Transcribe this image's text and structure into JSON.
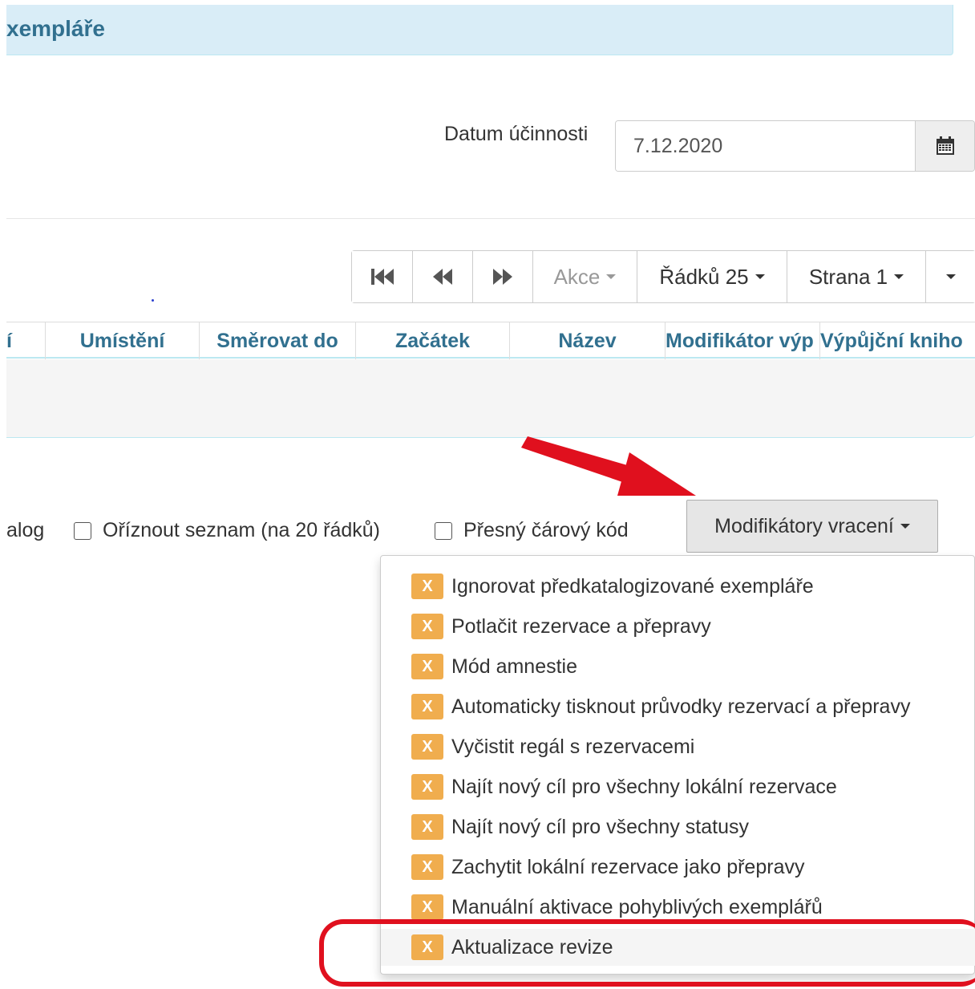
{
  "panel": {
    "title": "xempláře"
  },
  "date": {
    "label": "Datum účinnosti",
    "value": "7.12.2020"
  },
  "toolbar": {
    "first_icon": "first-page-icon",
    "prev_icon": "previous-page-icon",
    "next_icon": "next-page-icon",
    "actions_label": "Akce",
    "rows_label": "Řádků 25",
    "page_label": "Strana 1"
  },
  "table": {
    "columns": [
      "í",
      "Umístění",
      "Směrovat do",
      "Začátek",
      "Název",
      "Modifikátor výp",
      "Výpůjční kniho"
    ]
  },
  "options": {
    "catalog_label": "alog",
    "trim_label": "Oříznout seznam (na 20 řádků)",
    "exact_barcode_label": "Přesný čárový kód"
  },
  "modifiers": {
    "button_label": "Modifikátory vracení",
    "badge": "X",
    "items": [
      "Ignorovat předkatalogizované exempláře",
      "Potlačit rezervace a přepravy",
      "Mód amnestie",
      "Automaticky tisknout průvodky rezervací a přepravy",
      "Vyčistit regál s rezervacemi",
      "Najít nový cíl pro všechny lokální rezervace",
      "Najít nový cíl pro všechny statusy",
      "Zachytit lokální rezervace jako přepravy",
      "Manuální aktivace pohyblivých exemplářů",
      "Aktualizace revize"
    ]
  },
  "colors": {
    "accent": "#31708f",
    "badge": "#f0ad4e",
    "annotation": "#e0101e"
  }
}
